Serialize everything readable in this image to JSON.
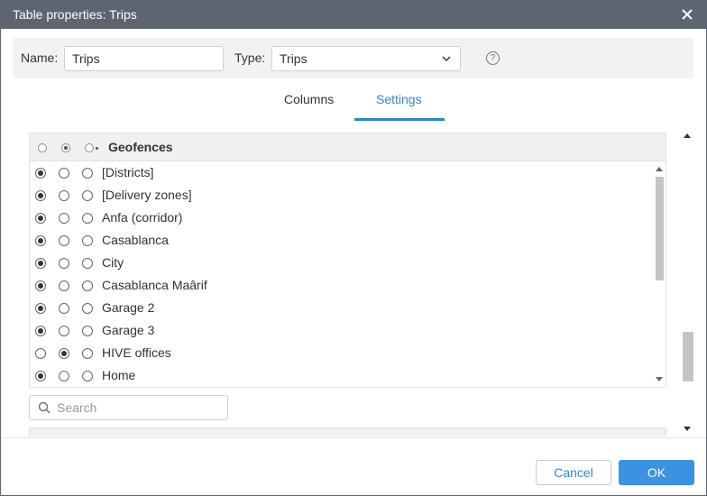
{
  "dialog": {
    "title": "Table properties: Trips"
  },
  "props": {
    "name_label": "Name:",
    "name_value": "Trips",
    "type_label": "Type:",
    "type_value": "Trips",
    "help_glyph": "?"
  },
  "tabs": [
    {
      "label": "Columns",
      "active": false
    },
    {
      "label": "Settings",
      "active": true
    }
  ],
  "geofences": {
    "title": "Geofences",
    "header_selected": 1,
    "items": [
      {
        "label": "[Districts]",
        "selected": 0
      },
      {
        "label": "[Delivery zones]",
        "selected": 0
      },
      {
        "label": "Anfa (corridor)",
        "selected": 0
      },
      {
        "label": "Casablanca",
        "selected": 0
      },
      {
        "label": "City",
        "selected": 0
      },
      {
        "label": "Casablanca Maârif",
        "selected": 0
      },
      {
        "label": "Garage 2",
        "selected": 0
      },
      {
        "label": "Garage 3",
        "selected": 0
      },
      {
        "label": "HIVE offices",
        "selected": 1
      },
      {
        "label": "Home",
        "selected": 0
      }
    ]
  },
  "search": {
    "placeholder": "Search"
  },
  "footer": {
    "cancel_label": "Cancel",
    "ok_label": "OK"
  },
  "colors": {
    "accent": "#2b86d6",
    "titlebar": "#5d6571"
  }
}
